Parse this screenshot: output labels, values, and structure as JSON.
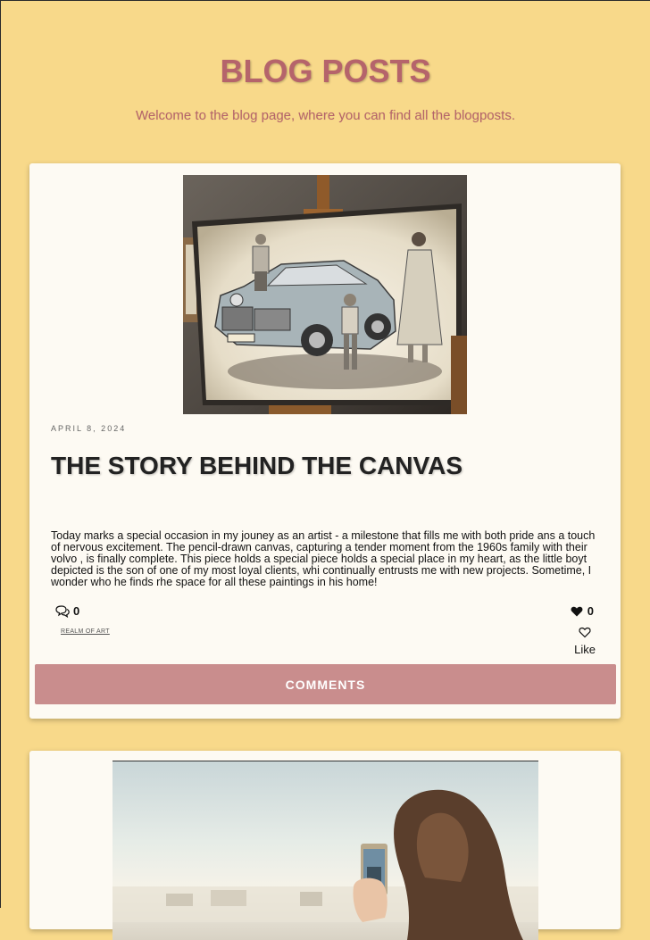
{
  "hero": {
    "title": "BLOG POSTS",
    "subtitle": "Welcome to the blog page, where you can find all the blogposts."
  },
  "posts": [
    {
      "date": "APRIL 8, 2024",
      "title": "THE STORY BEHIND THE CANVAS",
      "excerpt": "Today marks a special occasion in my jouney as an artist - a milestone that fills me with both pride ans a touch of nervous excitement. The pencil-drawn canvas, capturing a tender moment from the 1960s family with their volvo , is finally complete.  This piece holds a special piece holds a special place in my heart, as the little boyt depicted is the son of one of my most loyal clients, whi continually entrusts me with new projects. Sometime, I wonder who he finds rhe space for all these paintings in his home!",
      "comment_count": "0",
      "like_count": "0",
      "category": "REALM OF ART",
      "like_label": "Like",
      "comments_button": "COMMENTS",
      "image_icon": "pencil-drawing-family-car-image"
    },
    {
      "image_icon": "woman-phone-photo-image"
    }
  ],
  "colors": {
    "background": "#f8d98a",
    "accent": "#b5646b",
    "button": "#c98d8d",
    "card": "#fdfaf3"
  }
}
